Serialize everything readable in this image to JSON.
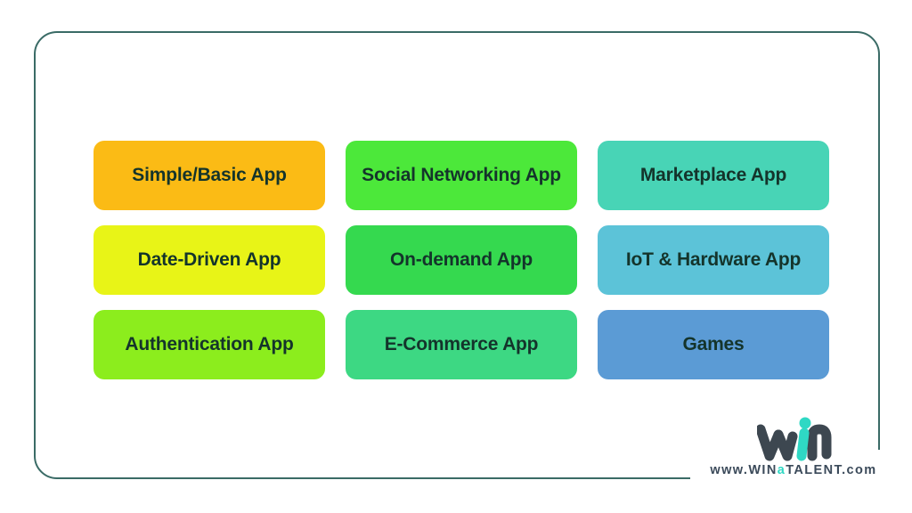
{
  "page": {
    "background_color": "#ffffff",
    "card_border_color": "#3a6b66",
    "tile_text_color": "#14342b"
  },
  "tiles": [
    {
      "label": "Simple/Basic App",
      "color": "#fbbb15",
      "name": "tile-simple-basic-app"
    },
    {
      "label": "Social Networking App",
      "color": "#4ce83a",
      "name": "tile-social-networking-app"
    },
    {
      "label": "Marketplace App",
      "color": "#48d4b6",
      "name": "tile-marketplace-app"
    },
    {
      "label": "Date-Driven App",
      "color": "#e8f417",
      "name": "tile-date-driven-app"
    },
    {
      "label": "On-demand App",
      "color": "#35d94f",
      "name": "tile-on-demand-app"
    },
    {
      "label": "IoT & Hardware App",
      "color": "#5cc3d8",
      "name": "tile-iot-hardware-app"
    },
    {
      "label": "Authentication App",
      "color": "#8ced1d",
      "name": "tile-authentication-app"
    },
    {
      "label": "E-Commerce App",
      "color": "#3dd883",
      "name": "tile-ecommerce-app"
    },
    {
      "label": "Games",
      "color": "#5b9bd5",
      "name": "tile-games"
    }
  ],
  "logo": {
    "mark_name": "win-logo-mark",
    "mark_dark_color": "#3d4750",
    "mark_accent_color": "#2fd8c4",
    "url_prefix": "www.WIN",
    "url_accent": "a",
    "url_suffix": "TALENT.com"
  }
}
